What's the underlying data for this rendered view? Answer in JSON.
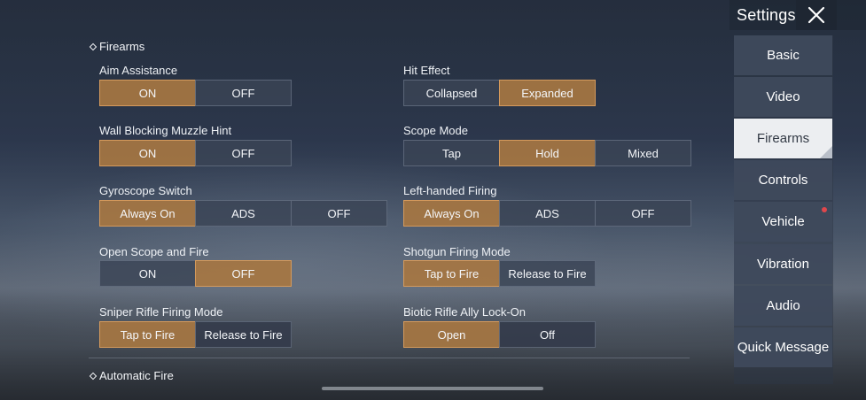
{
  "header": {
    "title": "Settings",
    "close_icon": "close-x-icon"
  },
  "sidebar": {
    "items": [
      {
        "label": "Basic",
        "active": false,
        "notification": false
      },
      {
        "label": "Video",
        "active": false,
        "notification": false
      },
      {
        "label": "Firearms",
        "active": true,
        "notification": false
      },
      {
        "label": "Controls",
        "active": false,
        "notification": false
      },
      {
        "label": "Vehicle",
        "active": false,
        "notification": true
      },
      {
        "label": "Vibration",
        "active": false,
        "notification": false
      },
      {
        "label": "Audio",
        "active": false,
        "notification": false
      },
      {
        "label": "Quick Message",
        "active": false,
        "notification": false
      }
    ]
  },
  "sections": {
    "firearms": "Firearms",
    "automatic_fire": "Automatic Fire"
  },
  "settings": {
    "aim_assistance": {
      "label": "Aim Assistance",
      "options": [
        "ON",
        "OFF"
      ],
      "selected": 0
    },
    "hit_effect": {
      "label": "Hit Effect",
      "options": [
        "Collapsed",
        "Expanded"
      ],
      "selected": 1
    },
    "wall_blocking": {
      "label": "Wall Blocking Muzzle Hint",
      "options": [
        "ON",
        "OFF"
      ],
      "selected": 0
    },
    "scope_mode": {
      "label": "Scope Mode",
      "options": [
        "Tap",
        "Hold",
        "Mixed"
      ],
      "selected": 1
    },
    "gyroscope": {
      "label": "Gyroscope Switch",
      "options": [
        "Always On",
        "ADS",
        "OFF"
      ],
      "selected": 0
    },
    "left_handed": {
      "label": "Left-handed Firing",
      "options": [
        "Always On",
        "ADS",
        "OFF"
      ],
      "selected": 0
    },
    "open_scope": {
      "label": "Open Scope and Fire",
      "options": [
        "ON",
        "OFF"
      ],
      "selected": 1
    },
    "shotgun": {
      "label": "Shotgun Firing Mode",
      "options": [
        "Tap to Fire",
        "Release to Fire"
      ],
      "selected": 0
    },
    "sniper": {
      "label": "Sniper Rifle Firing Mode",
      "options": [
        "Tap to Fire",
        "Release to Fire"
      ],
      "selected": 0
    },
    "biotic": {
      "label": "Biotic Rifle Ally Lock-On",
      "options": [
        "Open",
        "Off"
      ],
      "selected": 0
    }
  },
  "colors": {
    "selected": "#a67642",
    "unselected": "#3a4456",
    "active_tab": "#eceef1",
    "notification": "#e0474c"
  }
}
